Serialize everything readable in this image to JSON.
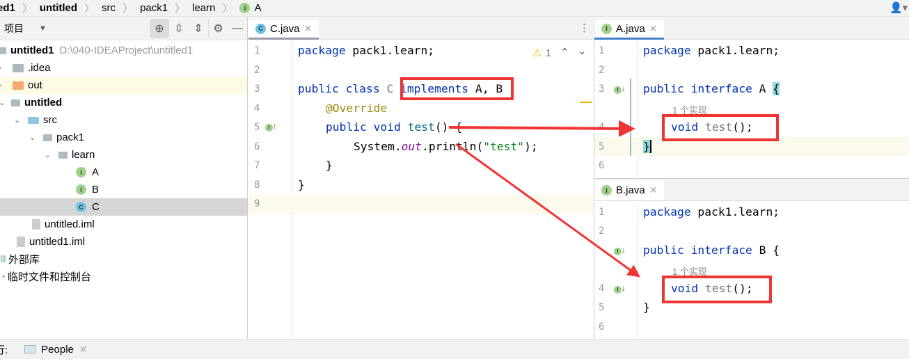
{
  "breadcrumb": [
    "ed1",
    "untitled",
    "src",
    "pack1",
    "learn",
    "A"
  ],
  "project_panel": {
    "title": "项目",
    "tree": [
      {
        "label": "untitled1",
        "path": "D:\\040-IDEAProject\\untitled1"
      },
      {
        "label": ".idea"
      },
      {
        "label": "out"
      },
      {
        "label": "untitled"
      },
      {
        "label": "src"
      },
      {
        "label": "pack1"
      },
      {
        "label": "learn"
      },
      {
        "label": "A"
      },
      {
        "label": "B"
      },
      {
        "label": "C"
      },
      {
        "label": "untitled.iml"
      },
      {
        "label": "untitled1.iml"
      },
      {
        "label": "外部库"
      },
      {
        "label": "临时文件和控制台"
      }
    ]
  },
  "editor_c": {
    "tab": "C.java",
    "warning_count": "1",
    "lines": [
      "1",
      "2",
      "3",
      "4",
      "5",
      "6",
      "7",
      "8",
      "9"
    ]
  },
  "editor_a": {
    "tab": "A.java",
    "hint": "1 个实现",
    "lines": [
      "1",
      "2",
      "3",
      "4",
      "5",
      "6"
    ]
  },
  "editor_b": {
    "tab": "B.java",
    "hint": "1 个实现",
    "lines": [
      "1",
      "2",
      "3",
      "4",
      "5",
      "6"
    ]
  },
  "code": {
    "package": "package",
    "pkgname": " pack1.learn;",
    "public": "public",
    "class": " class",
    "C": " C",
    "implements": "implements",
    "AB": " A, B",
    "override": "@Override",
    "void": " void",
    "test": " test",
    "paren": "() {",
    "system": "System.",
    "out": "out",
    "println": ".println(",
    "str": "\"test\"",
    "end": ");",
    "close": "}",
    "interface": " interface",
    "A": " A ",
    "B": " B ",
    "lb": "{",
    "voidi": "void",
    "testi": " test",
    "endi": "();"
  },
  "bottom": {
    "prefix": "行:",
    "tab": "People"
  },
  "colors": {
    "keyword": "#0033b3",
    "annotation": "#9e880d",
    "string": "#067d17",
    "annotation_box": "#f03333"
  }
}
